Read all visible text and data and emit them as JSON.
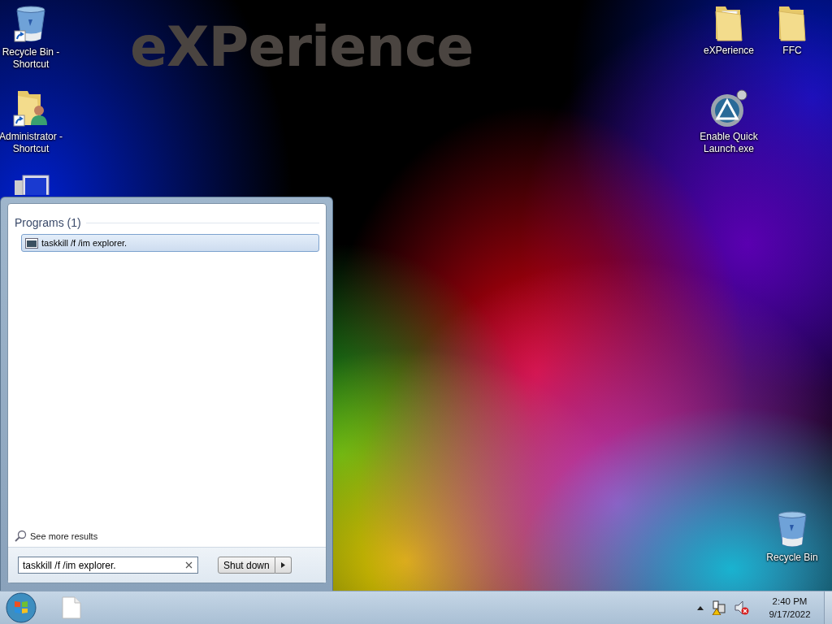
{
  "wallpaper": {
    "text": "eXPerience"
  },
  "desktop_icons": [
    {
      "kind": "recycle-shortcut",
      "label": "Recycle Bin - Shortcut"
    },
    {
      "kind": "user-shortcut",
      "label": "Administrator - Shortcut"
    },
    {
      "kind": "computer"
    },
    {
      "kind": "folder-docs",
      "label": "eXPerience"
    },
    {
      "kind": "folder",
      "label": "FFC"
    },
    {
      "kind": "app",
      "label": "Enable Quick Launch.exe"
    },
    {
      "kind": "recycle",
      "label": "Recycle Bin"
    }
  ],
  "start_menu": {
    "group_title": "Programs (1)",
    "results": [
      {
        "label": "taskkill /f /im explorer.",
        "selected": true
      }
    ],
    "see_more": "See more results",
    "search": {
      "value": "taskkill /f /im explorer."
    },
    "shutdown": {
      "label": "Shut down"
    }
  },
  "taskbar": {
    "pinned": [
      {
        "kind": "document"
      }
    ],
    "clock": {
      "time": "2:40 PM",
      "date": "9/17/2022"
    }
  }
}
